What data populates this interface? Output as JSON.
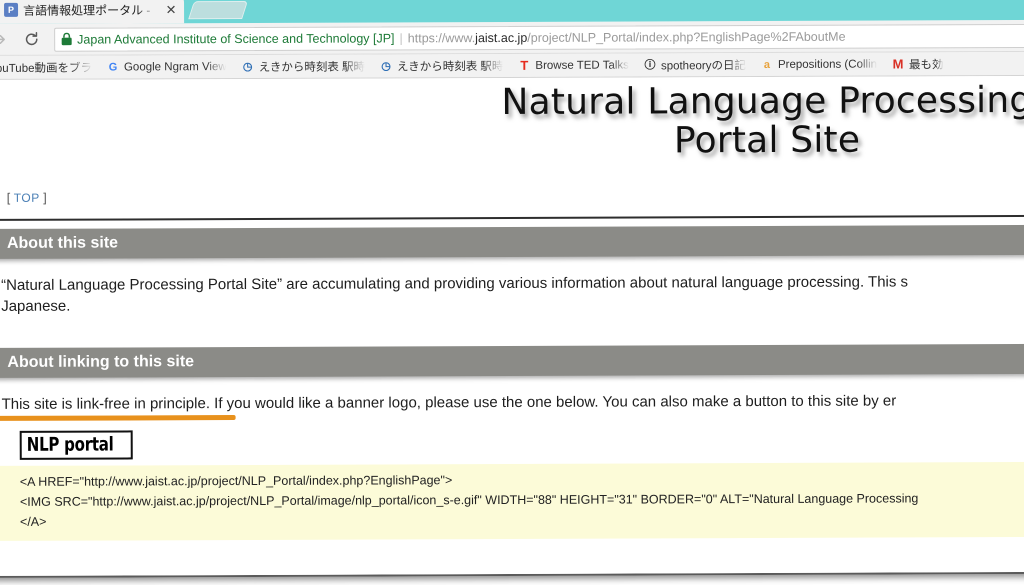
{
  "browser": {
    "tab": {
      "title": "言語情報処理ポータル -",
      "favicon_letter": "P",
      "close_label": "✕"
    },
    "toolbar": {
      "forward_icon": "forward-arrow-icon",
      "reload_icon": "reload-icon",
      "site_identity": "Japan Advanced Institute of Science and Technology [JP]",
      "separator": "|",
      "url_scheme": "https://www.",
      "url_domain": "jaist.ac.jp",
      "url_path": "/project/NLP_Portal/index.php?EnglishPage%2FAboutMe"
    },
    "bookmarks": [
      {
        "label": "YouTube動画をブラ",
        "icon": ""
      },
      {
        "label": "Google Ngram View",
        "icon": "G"
      },
      {
        "label": "えきから時刻表 駅時",
        "icon": "◷"
      },
      {
        "label": "えきから時刻表 駅時",
        "icon": "◷"
      },
      {
        "label": "Browse TED Talks",
        "icon": "T"
      },
      {
        "label": "spotheoryの日記",
        "icon": "ⓘ"
      },
      {
        "label": "Prepositions (Collin",
        "icon": "a"
      },
      {
        "label": "最も効",
        "icon": "M"
      }
    ]
  },
  "page": {
    "site_title": "Natural Language Processing\nPortal Site",
    "nav": {
      "bracket_open": "[",
      "top_link": "TOP",
      "bracket_close": "]"
    },
    "sections": [
      {
        "heading": "About this site",
        "paragraph_line1": "“Natural Language Processing Portal Site” are accumulating and providing various information about natural language processing. This s",
        "paragraph_line2": "Japanese."
      },
      {
        "heading": "About linking to this site",
        "paragraph_highlight": "This site is link-free in principle.",
        "paragraph_rest": " If you would like a banner logo, please use the one below. You can also make a button to this site by er"
      }
    ],
    "banner_logo_text": "NLP portal",
    "code_lines": [
      "<A HREF=\"http://www.jaist.ac.jp/project/NLP_Portal/index.php?EnglishPage\">",
      "<IMG SRC=\"http://www.jaist.ac.jp/project/NLP_Portal/image/nlp_portal/icon_s-e.gif\" WIDTH=\"88\" HEIGHT=\"31\" BORDER=\"0\" ALT=\"Natural Language Processing",
      "</A>"
    ]
  },
  "colors": {
    "tab_strip": "#6fd6d6",
    "section_header": "#8b8b87",
    "highlight_underline": "#e8911c",
    "code_background": "#fcfbd8",
    "link_blue": "#4a7fb5",
    "secure_green": "#1d7a37"
  }
}
